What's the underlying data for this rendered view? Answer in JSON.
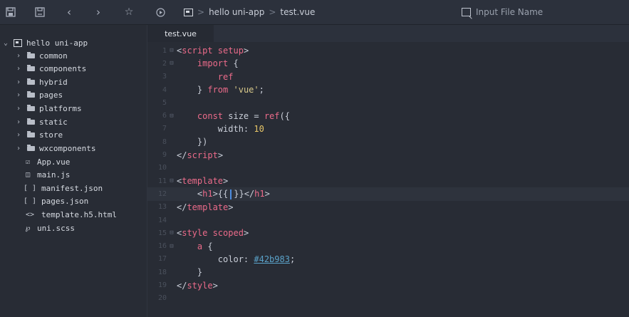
{
  "toolbar": {
    "icons": [
      "save-icon",
      "save-alt-icon",
      "back-icon",
      "forward-icon",
      "star-icon",
      "run-icon"
    ],
    "breadcrumb": [
      "hello uni-app",
      "test.vue"
    ],
    "breadcrumb_separator": ">",
    "search_placeholder": "Input File Name"
  },
  "sidebar": {
    "root": "hello uni-app",
    "folders": [
      "common",
      "components",
      "hybrid",
      "pages",
      "platforms",
      "static",
      "store",
      "wxcomponents"
    ],
    "files": [
      {
        "icon": "vue-file-icon",
        "glyph": "☑",
        "name": "App.vue"
      },
      {
        "icon": "js-file-icon",
        "glyph": "◫",
        "name": "main.js"
      },
      {
        "icon": "json-file-icon",
        "glyph": "[ ]",
        "name": "manifest.json"
      },
      {
        "icon": "json-file-icon",
        "glyph": "[ ]",
        "name": "pages.json"
      },
      {
        "icon": "html-file-icon",
        "glyph": "<>",
        "name": "template.h5.html"
      },
      {
        "icon": "scss-file-icon",
        "glyph": "℘",
        "name": "uni.scss"
      }
    ]
  },
  "tabs": [
    {
      "label": "test.vue"
    }
  ],
  "editor": {
    "lines": [
      {
        "n": "1",
        "fold": "⊟",
        "tokens": [
          {
            "t": "<",
            "c": "code"
          },
          {
            "t": "script setup",
            "c": "kw"
          },
          {
            "t": ">",
            "c": "code"
          }
        ]
      },
      {
        "n": "2",
        "fold": "⊟",
        "tokens": [
          {
            "t": "    ",
            "c": "code"
          },
          {
            "t": "import",
            "c": "kw"
          },
          {
            "t": " {",
            "c": "code"
          }
        ]
      },
      {
        "n": "3",
        "fold": "",
        "tokens": [
          {
            "t": "        ",
            "c": "code"
          },
          {
            "t": "ref",
            "c": "kw"
          }
        ]
      },
      {
        "n": "4",
        "fold": "",
        "tokens": [
          {
            "t": "    } ",
            "c": "code"
          },
          {
            "t": "from",
            "c": "kw"
          },
          {
            "t": " ",
            "c": "code"
          },
          {
            "t": "'vue'",
            "c": "str"
          },
          {
            "t": ";",
            "c": "code"
          }
        ]
      },
      {
        "n": "5",
        "fold": "",
        "tokens": []
      },
      {
        "n": "6",
        "fold": "⊟",
        "tokens": [
          {
            "t": "    ",
            "c": "code"
          },
          {
            "t": "const",
            "c": "kw"
          },
          {
            "t": " size = ",
            "c": "code"
          },
          {
            "t": "ref",
            "c": "fn"
          },
          {
            "t": "({",
            "c": "code"
          }
        ]
      },
      {
        "n": "7",
        "fold": "",
        "tokens": [
          {
            "t": "        width: ",
            "c": "code"
          },
          {
            "t": "10",
            "c": "num"
          }
        ]
      },
      {
        "n": "8",
        "fold": "",
        "tokens": [
          {
            "t": "    })",
            "c": "code"
          }
        ]
      },
      {
        "n": "9",
        "fold": "",
        "tokens": [
          {
            "t": "</",
            "c": "code"
          },
          {
            "t": "script",
            "c": "kw"
          },
          {
            "t": ">",
            "c": "code"
          }
        ]
      },
      {
        "n": "10",
        "fold": "",
        "tokens": []
      },
      {
        "n": "11",
        "fold": "⊟",
        "tokens": [
          {
            "t": "<",
            "c": "code"
          },
          {
            "t": "template",
            "c": "kw"
          },
          {
            "t": ">",
            "c": "code"
          }
        ]
      },
      {
        "n": "12",
        "fold": "",
        "highlight": true,
        "tokens": [
          {
            "t": "    <",
            "c": "code"
          },
          {
            "t": "h1",
            "c": "kw"
          },
          {
            "t": ">{{",
            "c": "code"
          },
          {
            "t": "|",
            "c": "cursor"
          },
          {
            "t": "}}</",
            "c": "code"
          },
          {
            "t": "h1",
            "c": "kw"
          },
          {
            "t": ">",
            "c": "code"
          }
        ]
      },
      {
        "n": "13",
        "fold": "",
        "tokens": [
          {
            "t": "</",
            "c": "code"
          },
          {
            "t": "template",
            "c": "kw"
          },
          {
            "t": ">",
            "c": "code"
          }
        ]
      },
      {
        "n": "14",
        "fold": "",
        "tokens": []
      },
      {
        "n": "15",
        "fold": "⊟",
        "tokens": [
          {
            "t": "<",
            "c": "code"
          },
          {
            "t": "style scoped",
            "c": "kw"
          },
          {
            "t": ">",
            "c": "code"
          }
        ]
      },
      {
        "n": "16",
        "fold": "⊟",
        "tokens": [
          {
            "t": "    ",
            "c": "code"
          },
          {
            "t": "a",
            "c": "kw"
          },
          {
            "t": " {",
            "c": "code"
          }
        ]
      },
      {
        "n": "17",
        "fold": "",
        "tokens": [
          {
            "t": "        color: ",
            "c": "code"
          },
          {
            "t": "#42b983",
            "c": "col"
          },
          {
            "t": ";",
            "c": "code"
          }
        ]
      },
      {
        "n": "18",
        "fold": "",
        "tokens": [
          {
            "t": "    }",
            "c": "code"
          }
        ]
      },
      {
        "n": "19",
        "fold": "",
        "tokens": [
          {
            "t": "</",
            "c": "code"
          },
          {
            "t": "style",
            "c": "kw"
          },
          {
            "t": ">",
            "c": "code"
          }
        ]
      },
      {
        "n": "20",
        "fold": "",
        "tokens": []
      }
    ]
  }
}
